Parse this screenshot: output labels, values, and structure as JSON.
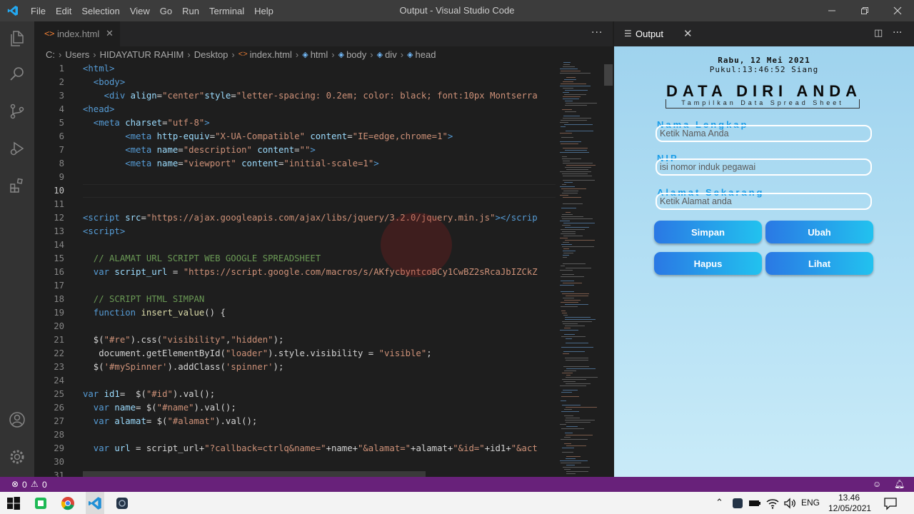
{
  "window": {
    "menu": [
      "File",
      "Edit",
      "Selection",
      "View",
      "Go",
      "Run",
      "Terminal",
      "Help"
    ],
    "title": "Output - Visual Studio Code"
  },
  "editor": {
    "tab_label": "index.html",
    "tab_icon": "<>",
    "breadcrumb": [
      "C:",
      "Users",
      "HIDAYATUR RAHIM",
      "Desktop",
      "index.html",
      "html",
      "body",
      "div",
      "head"
    ],
    "lines": [
      {
        "n": "1",
        "segs": [
          [
            "<html>",
            "#569cd6"
          ]
        ]
      },
      {
        "n": "2",
        "segs": [
          [
            "  <body>",
            "#569cd6"
          ]
        ]
      },
      {
        "n": "3",
        "segs": [
          [
            "    <div ",
            "#569cd6"
          ],
          [
            "align",
            "#9cdcfe"
          ],
          [
            "=",
            "#d4d4d4"
          ],
          [
            "\"center\"",
            "#ce9178"
          ],
          [
            "style",
            "#9cdcfe"
          ],
          [
            "=",
            "#d4d4d4"
          ],
          [
            "\"letter-spacing: 0.2em; color: black; font:10px Montserra",
            "#ce9178"
          ]
        ]
      },
      {
        "n": "4",
        "segs": [
          [
            "<head>",
            "#569cd6"
          ]
        ]
      },
      {
        "n": "5",
        "segs": [
          [
            "  <meta ",
            "#569cd6"
          ],
          [
            "charset",
            "#9cdcfe"
          ],
          [
            "=",
            "#d4d4d4"
          ],
          [
            "\"utf-8\"",
            "#ce9178"
          ],
          [
            ">",
            "#569cd6"
          ]
        ]
      },
      {
        "n": "6",
        "segs": [
          [
            "        <meta ",
            "#569cd6"
          ],
          [
            "http-equiv",
            "#9cdcfe"
          ],
          [
            "=",
            "#d4d4d4"
          ],
          [
            "\"X-UA-Compatible\"",
            "#ce9178"
          ],
          [
            " content",
            "#9cdcfe"
          ],
          [
            "=",
            "#d4d4d4"
          ],
          [
            "\"IE=edge,chrome=1\"",
            "#ce9178"
          ],
          [
            ">",
            "#569cd6"
          ]
        ]
      },
      {
        "n": "7",
        "segs": [
          [
            "        <meta ",
            "#569cd6"
          ],
          [
            "name",
            "#9cdcfe"
          ],
          [
            "=",
            "#d4d4d4"
          ],
          [
            "\"description\"",
            "#ce9178"
          ],
          [
            " content",
            "#9cdcfe"
          ],
          [
            "=",
            "#d4d4d4"
          ],
          [
            "\"\"",
            "#ce9178"
          ],
          [
            ">",
            "#569cd6"
          ]
        ]
      },
      {
        "n": "8",
        "segs": [
          [
            "        <meta ",
            "#569cd6"
          ],
          [
            "name",
            "#9cdcfe"
          ],
          [
            "=",
            "#d4d4d4"
          ],
          [
            "\"viewport\"",
            "#ce9178"
          ],
          [
            " content",
            "#9cdcfe"
          ],
          [
            "=",
            "#d4d4d4"
          ],
          [
            "\"initial-scale=1\"",
            "#ce9178"
          ],
          [
            ">",
            "#569cd6"
          ]
        ]
      },
      {
        "n": "9",
        "segs": []
      },
      {
        "n": "10",
        "segs": []
      },
      {
        "n": "11",
        "segs": []
      },
      {
        "n": "12",
        "segs": [
          [
            "<script ",
            "#569cd6"
          ],
          [
            "src",
            "#9cdcfe"
          ],
          [
            "=",
            "#d4d4d4"
          ],
          [
            "\"https://ajax.googleapis.com/ajax/libs/jquery/3.2.0/jquery.min.js\"",
            "#ce9178"
          ],
          [
            "></scrip",
            "#569cd6"
          ]
        ]
      },
      {
        "n": "13",
        "segs": [
          [
            "<script>",
            "#569cd6"
          ]
        ]
      },
      {
        "n": "14",
        "segs": []
      },
      {
        "n": "15",
        "segs": [
          [
            "  // ALAMAT URL SCRIPT WEB GOOGLE SPREADSHEET",
            "#6a9955"
          ]
        ]
      },
      {
        "n": "16",
        "segs": [
          [
            "  var ",
            "#569cd6"
          ],
          [
            "script_url",
            "#9cdcfe"
          ],
          [
            " = ",
            "#d4d4d4"
          ],
          [
            "\"https://script.google.com/macros/s/AKfycbyntcoBCy1CwBZ2sRcaJbIZCkZ",
            "#ce9178"
          ]
        ]
      },
      {
        "n": "17",
        "segs": []
      },
      {
        "n": "18",
        "segs": [
          [
            "  // SCRIPT HTML SIMPAN",
            "#6a9955"
          ]
        ]
      },
      {
        "n": "19",
        "segs": [
          [
            "  function ",
            "#569cd6"
          ],
          [
            "insert_value",
            "#dcdcaa"
          ],
          [
            "() {",
            "#d4d4d4"
          ]
        ]
      },
      {
        "n": "20",
        "segs": []
      },
      {
        "n": "21",
        "segs": [
          [
            "  $(",
            "#d4d4d4"
          ],
          [
            "\"#re\"",
            "#ce9178"
          ],
          [
            ").css(",
            "#d4d4d4"
          ],
          [
            "\"visibility\"",
            "#ce9178"
          ],
          [
            ",",
            "#d4d4d4"
          ],
          [
            "\"hidden\"",
            "#ce9178"
          ],
          [
            ");",
            "#d4d4d4"
          ]
        ]
      },
      {
        "n": "22",
        "segs": [
          [
            "   document.getElementById(",
            "#d4d4d4"
          ],
          [
            "\"loader\"",
            "#ce9178"
          ],
          [
            ").style.visibility = ",
            "#d4d4d4"
          ],
          [
            "\"visible\"",
            "#ce9178"
          ],
          [
            ";",
            "#d4d4d4"
          ]
        ]
      },
      {
        "n": "23",
        "segs": [
          [
            "  $(",
            "#d4d4d4"
          ],
          [
            "'#mySpinner'",
            "#ce9178"
          ],
          [
            ").addClass(",
            "#d4d4d4"
          ],
          [
            "'spinner'",
            "#ce9178"
          ],
          [
            ");",
            "#d4d4d4"
          ]
        ]
      },
      {
        "n": "24",
        "segs": []
      },
      {
        "n": "25",
        "segs": [
          [
            "var ",
            "#569cd6"
          ],
          [
            "id1",
            "#9cdcfe"
          ],
          [
            "=  $(",
            "#d4d4d4"
          ],
          [
            "\"#id\"",
            "#ce9178"
          ],
          [
            ").val();",
            "#d4d4d4"
          ]
        ]
      },
      {
        "n": "26",
        "segs": [
          [
            "  var ",
            "#569cd6"
          ],
          [
            "name",
            "#9cdcfe"
          ],
          [
            "= $(",
            "#d4d4d4"
          ],
          [
            "\"#name\"",
            "#ce9178"
          ],
          [
            ").val();",
            "#d4d4d4"
          ]
        ]
      },
      {
        "n": "27",
        "segs": [
          [
            "  var ",
            "#569cd6"
          ],
          [
            "alamat",
            "#9cdcfe"
          ],
          [
            "= $(",
            "#d4d4d4"
          ],
          [
            "\"#alamat\"",
            "#ce9178"
          ],
          [
            ").val();",
            "#d4d4d4"
          ]
        ]
      },
      {
        "n": "28",
        "segs": []
      },
      {
        "n": "29",
        "segs": [
          [
            "  var ",
            "#569cd6"
          ],
          [
            "url",
            "#9cdcfe"
          ],
          [
            " = script_url+",
            "#d4d4d4"
          ],
          [
            "\"?callback=ctrlq&name=\"",
            "#ce9178"
          ],
          [
            "+name+",
            "#d4d4d4"
          ],
          [
            "\"&alamat=\"",
            "#ce9178"
          ],
          [
            "+alamat+",
            "#d4d4d4"
          ],
          [
            "\"&id=\"",
            "#ce9178"
          ],
          [
            "+id1+",
            "#d4d4d4"
          ],
          [
            "\"&act",
            "#ce9178"
          ]
        ]
      },
      {
        "n": "30",
        "segs": []
      },
      {
        "n": "31",
        "segs": []
      }
    ],
    "current_line": "10"
  },
  "output_panel": {
    "title": "Output",
    "date": "Rabu, 12 Mei 2021",
    "time": "Pukul:13:46:52 Siang",
    "heading": "DATA DIRI ANDA",
    "subheading": "Tampilkan Data Spread Sheet",
    "fields": [
      {
        "label": "Nama Lengkap",
        "placeholder": "Ketik Nama Anda"
      },
      {
        "label": "NIP",
        "placeholder": "isi nomor induk pegawai"
      },
      {
        "label": "Alamat Sekarang",
        "placeholder": "Ketik Alamat anda"
      }
    ],
    "buttons": [
      "Simpan",
      "Ubah",
      "Hapus",
      "Lihat"
    ]
  },
  "statusbar": {
    "errors": "0",
    "warnings": "0",
    "color": "#68217a"
  },
  "taskbar": {
    "language": "ENG",
    "time": "13.46",
    "date": "12/05/2021"
  }
}
